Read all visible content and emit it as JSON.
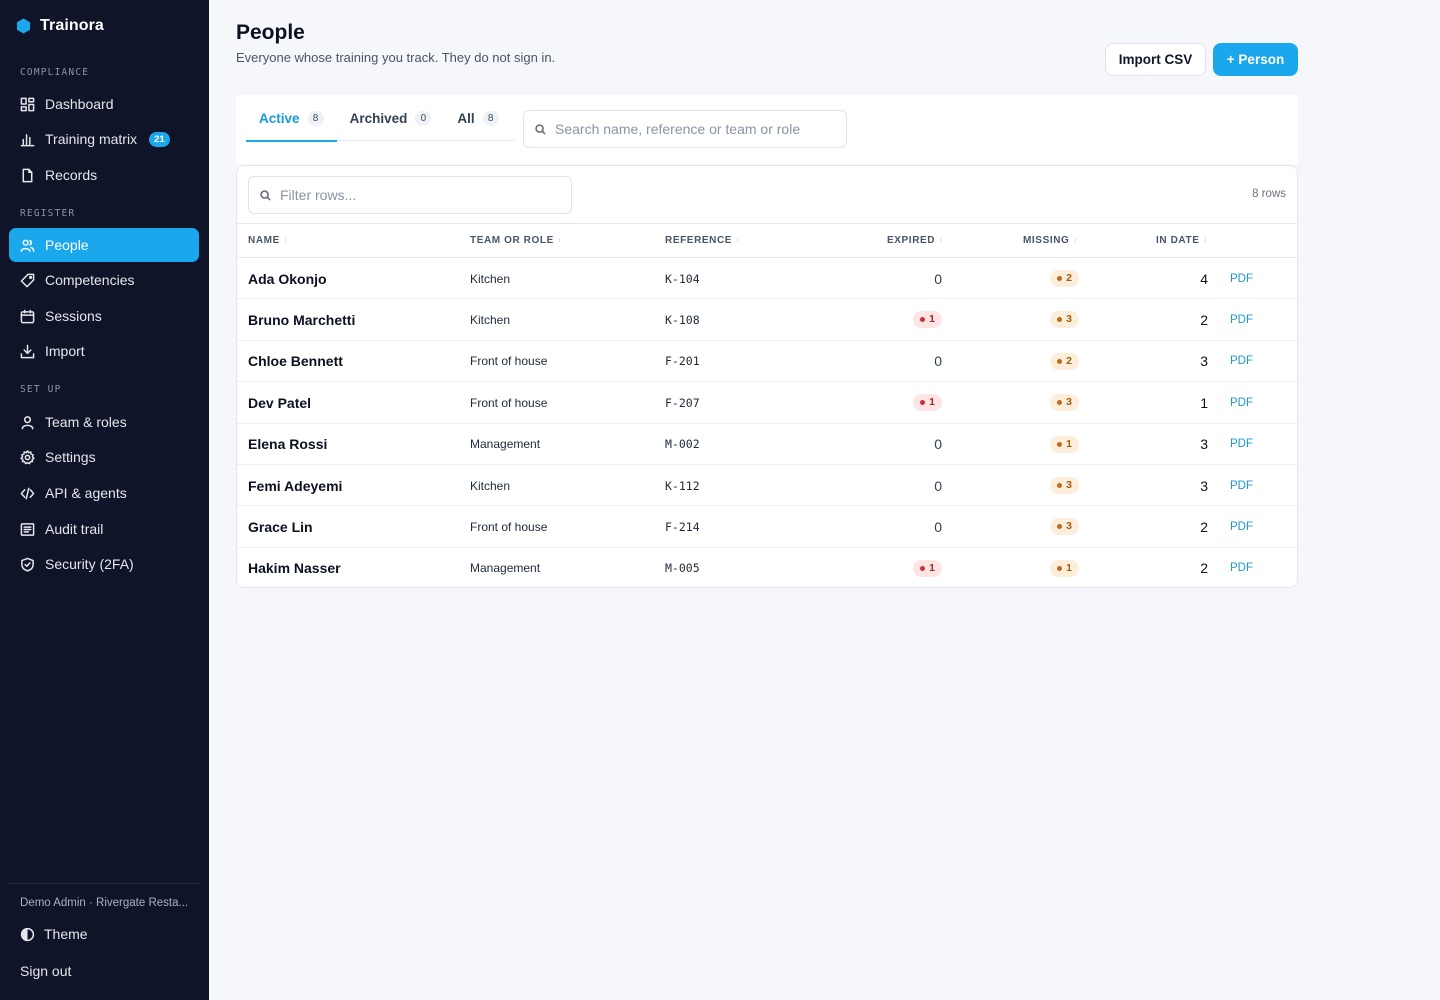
{
  "brand": {
    "name": "Trainora",
    "color": "#1ba7ec"
  },
  "sidebar": {
    "sections": [
      {
        "label": "COMPLIANCE",
        "items": [
          {
            "label": "Dashboard",
            "icon": "dashboard-icon"
          },
          {
            "label": "Training matrix",
            "icon": "bar-chart-icon",
            "badge": "21"
          },
          {
            "label": "Records",
            "icon": "file-icon"
          }
        ]
      },
      {
        "label": "REGISTER",
        "items": [
          {
            "label": "People",
            "icon": "people-icon",
            "active": true
          },
          {
            "label": "Competencies",
            "icon": "tag-icon"
          },
          {
            "label": "Sessions",
            "icon": "calendar-icon"
          },
          {
            "label": "Import",
            "icon": "download-icon"
          }
        ]
      },
      {
        "label": "SET UP",
        "items": [
          {
            "label": "Team & roles",
            "icon": "user-icon"
          },
          {
            "label": "Settings",
            "icon": "gear-icon"
          },
          {
            "label": "API & agents",
            "icon": "code-icon"
          },
          {
            "label": "Audit trail",
            "icon": "list-icon"
          },
          {
            "label": "Security (2FA)",
            "icon": "shield-icon"
          }
        ]
      }
    ],
    "user": "Demo Admin · Rivergate Resta...",
    "theme_label": "Theme",
    "signout_label": "Sign out"
  },
  "header": {
    "title": "People",
    "subtitle": "Everyone whose training you track. They do not sign in.",
    "import_label": "Import CSV",
    "add_label": "+ Person"
  },
  "tabs": [
    {
      "label": "Active",
      "count": "8",
      "active": true
    },
    {
      "label": "Archived",
      "count": "0"
    },
    {
      "label": "All",
      "count": "8"
    }
  ],
  "search": {
    "placeholder": "Search name, reference or team or role"
  },
  "table": {
    "filter_placeholder": "Filter rows...",
    "row_count": "8 rows",
    "columns": [
      "NAME",
      "TEAM OR ROLE",
      "REFERENCE",
      "EXPIRED",
      "MISSING",
      "IN DATE"
    ],
    "pdf_label": "PDF",
    "rows": [
      {
        "name": "Ada Okonjo",
        "team": "Kitchen",
        "reference": "K-104",
        "expired": "0",
        "missing": "2",
        "in_date": "4"
      },
      {
        "name": "Bruno Marchetti",
        "team": "Kitchen",
        "reference": "K-108",
        "expired": "1",
        "missing": "3",
        "in_date": "2"
      },
      {
        "name": "Chloe Bennett",
        "team": "Front of house",
        "reference": "F-201",
        "expired": "0",
        "missing": "2",
        "in_date": "3"
      },
      {
        "name": "Dev Patel",
        "team": "Front of house",
        "reference": "F-207",
        "expired": "1",
        "missing": "3",
        "in_date": "1"
      },
      {
        "name": "Elena Rossi",
        "team": "Management",
        "reference": "M-002",
        "expired": "0",
        "missing": "1",
        "in_date": "3"
      },
      {
        "name": "Femi Adeyemi",
        "team": "Kitchen",
        "reference": "K-112",
        "expired": "0",
        "missing": "3",
        "in_date": "3"
      },
      {
        "name": "Grace Lin",
        "team": "Front of house",
        "reference": "F-214",
        "expired": "0",
        "missing": "3",
        "in_date": "2"
      },
      {
        "name": "Hakim Nasser",
        "team": "Management",
        "reference": "M-005",
        "expired": "1",
        "missing": "1",
        "in_date": "2"
      }
    ]
  }
}
